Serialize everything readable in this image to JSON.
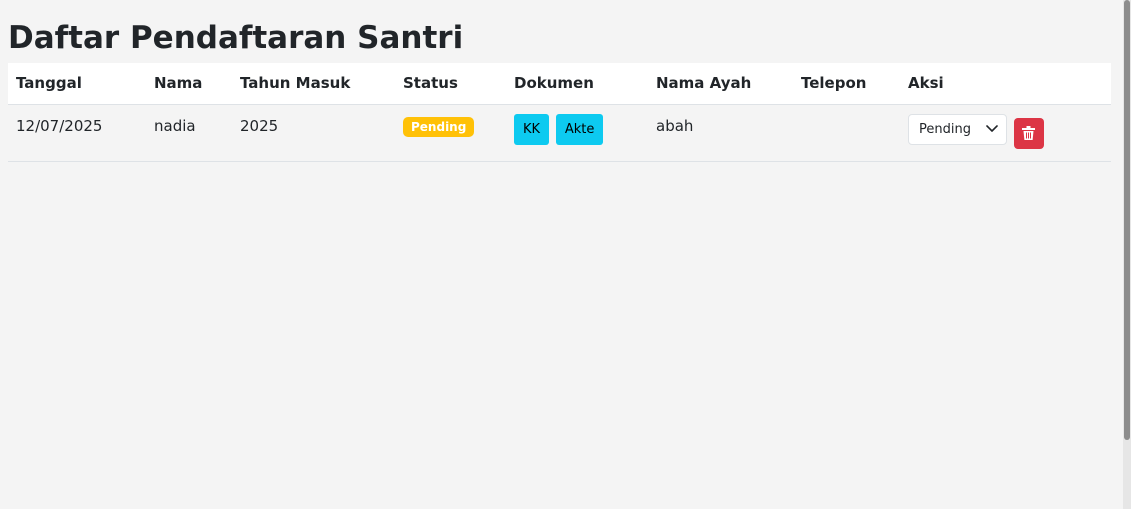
{
  "page": {
    "title": "Daftar Pendaftaran Santri"
  },
  "table": {
    "headers": {
      "tanggal": "Tanggal",
      "nama": "Nama",
      "tahun_masuk": "Tahun Masuk",
      "status": "Status",
      "dokumen": "Dokumen",
      "nama_ayah": "Nama Ayah",
      "telepon": "Telepon",
      "aksi": "Aksi"
    },
    "rows": [
      {
        "tanggal": "12/07/2025",
        "nama": "nadia",
        "tahun_masuk": "2025",
        "status": "Pending",
        "dokumen": [
          "KK",
          "Akte"
        ],
        "nama_ayah": "abah",
        "telepon": "",
        "aksi_status": "Pending",
        "delete_icon": "trash-icon"
      }
    ]
  },
  "colors": {
    "pending_badge": "#ffc107",
    "document_button": "#0dcaf0",
    "delete_button": "#dc3545",
    "header_background": "#ffffff",
    "page_background": "#f4f4f4"
  }
}
